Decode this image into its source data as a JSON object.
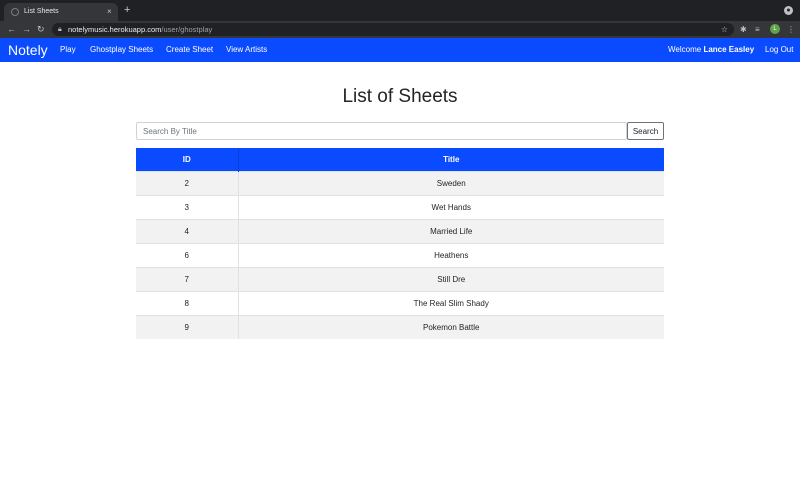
{
  "browser": {
    "tab_title": "List Sheets",
    "tab_close": "×",
    "new_tab": "+",
    "url_host": "notelymusic.herokuapp.com",
    "url_path": "/user/ghostplay",
    "avatar_letter": "L"
  },
  "navbar": {
    "brand": "Notely",
    "links": [
      "Play",
      "Ghostplay Sheets",
      "Create Sheet",
      "View Artists"
    ],
    "welcome_prefix": "Welcome",
    "user_name": "Lance Easley",
    "logout_label": "Log Out"
  },
  "page": {
    "title": "List of Sheets"
  },
  "search": {
    "placeholder": "Search By Title",
    "button_label": "Search"
  },
  "table": {
    "headers": [
      "ID",
      "Title"
    ],
    "rows": [
      {
        "id": "2",
        "title": "Sweden"
      },
      {
        "id": "3",
        "title": "Wet Hands"
      },
      {
        "id": "4",
        "title": "Married Life"
      },
      {
        "id": "6",
        "title": "Heathens"
      },
      {
        "id": "7",
        "title": "Still Dre"
      },
      {
        "id": "8",
        "title": "The Real Slim Shady"
      },
      {
        "id": "9",
        "title": "Pokemon Battle"
      }
    ]
  },
  "colors": {
    "accent": "#0a4bff",
    "chrome_dark": "#202124",
    "chrome_toolbar": "#35363a",
    "row_stripe": "#f2f2f2"
  }
}
